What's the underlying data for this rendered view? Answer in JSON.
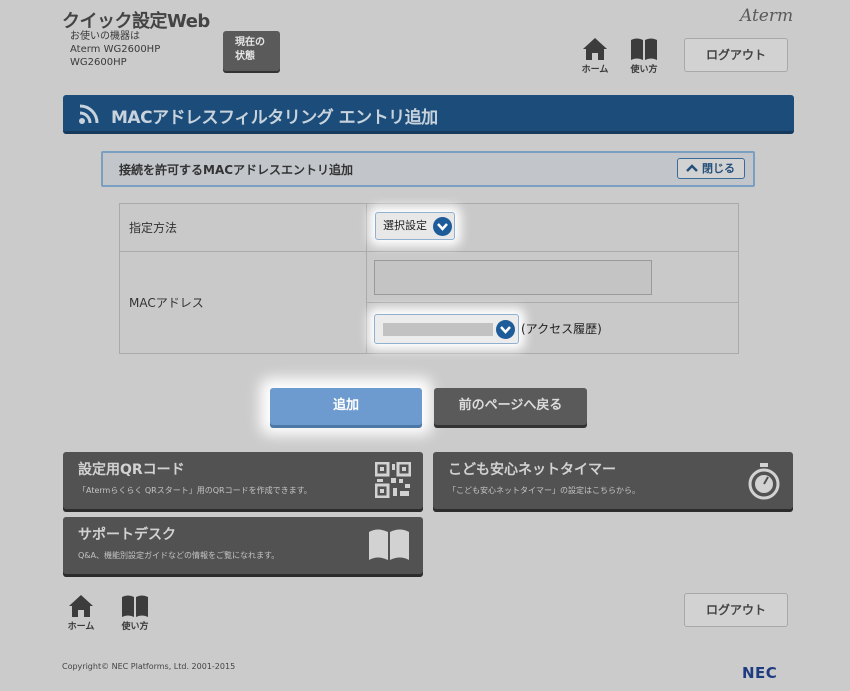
{
  "header": {
    "app_title": "クイック設定Web",
    "device_label": "お使いの機器は",
    "device_name_line1": "Aterm WG2600HP",
    "device_name_line2": "WG2600HP",
    "status_button": {
      "line1": "現在の",
      "line2": "状態"
    },
    "brand_logo": "Aterm",
    "nav": {
      "home_label": "ホーム",
      "manual_label": "使い方"
    },
    "logout_label": "ログアウト"
  },
  "page": {
    "title": "MACアドレスフィルタリング エントリ追加",
    "section_title": "接続を許可するMACアドレスエントリ追加",
    "close_label": "閉じる"
  },
  "form": {
    "method_label": "指定方法",
    "method_value": "選択設定",
    "mac_label": "MACアドレス",
    "mac_value": "",
    "history_label": "(アクセス履歴)"
  },
  "buttons": {
    "add": "追加",
    "back": "前のページへ戻る"
  },
  "cards": [
    {
      "title": "設定用QRコード",
      "desc": "「Atermらくらく QRスタート」用のQRコードを作成できます。",
      "icon": "qr-code-icon"
    },
    {
      "title": "こども安心ネットタイマー",
      "desc": "「こども安心ネットタイマー」の設定はこちらから。",
      "icon": "stopwatch-icon"
    },
    {
      "title": "サポートデスク",
      "desc": "Q&A、機能別設定ガイドなどの情報をご覧になれます。",
      "icon": "book-icon"
    }
  ],
  "footer": {
    "home_label": "ホーム",
    "manual_label": "使い方",
    "logout_label": "ログアウト",
    "copyright": "Copyright© NEC Platforms, Ltd. 2001-2015",
    "nec_logo": "NEC"
  },
  "colors": {
    "title_bar": "#1c4d7a",
    "accent_blue": "#1e5c99",
    "add_button": "#6d9bcf",
    "card_bg": "#525252"
  }
}
